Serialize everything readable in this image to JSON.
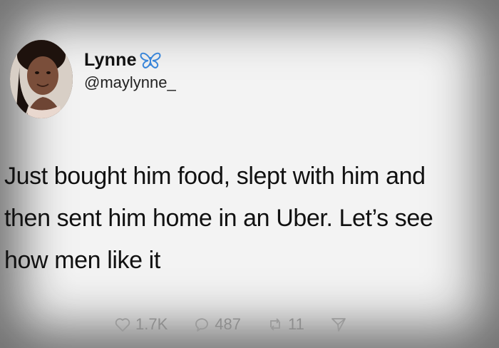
{
  "user": {
    "display_name": "Lynne",
    "handle": "@maylynne_",
    "verified_icon": "butterfly-icon",
    "avatar": "profile-photo"
  },
  "tweet": {
    "lines": [
      "Just bought him food, slept with him and",
      "then sent him home in an Uber. Let’s see",
      "how men like it"
    ]
  },
  "actions": {
    "likes": "1.7K",
    "replies": "487",
    "retweets": "11",
    "like_icon": "heart-icon",
    "reply_icon": "comment-icon",
    "retweet_icon": "retweet-icon",
    "share_icon": "share-icon"
  },
  "colors": {
    "background": "#f3f3f3",
    "text": "#111111",
    "muted": "#8e8e8e",
    "butterfly_blue": "#3a86d9"
  }
}
